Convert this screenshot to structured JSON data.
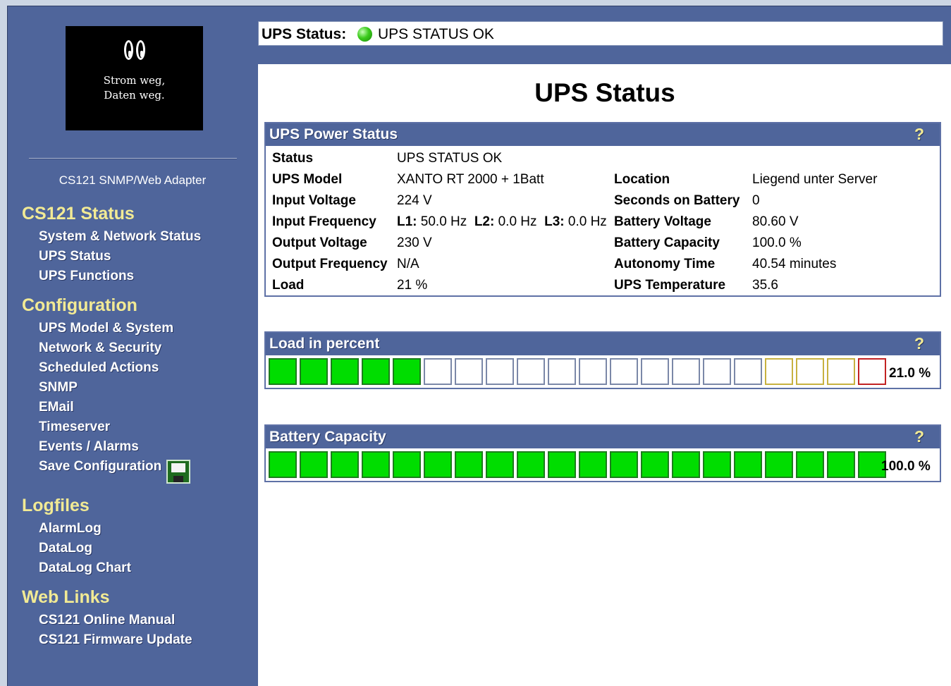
{
  "logo": {
    "line1": "Strom weg,",
    "line2": "Daten weg."
  },
  "sidebar": {
    "adapter_name": "CS121 SNMP/Web Adapter",
    "sections": [
      {
        "title": "CS121 Status",
        "items": [
          "System & Network Status",
          "UPS Status",
          "UPS Functions"
        ]
      },
      {
        "title": "Configuration",
        "items": [
          "UPS Model & System",
          "Network & Security",
          "Scheduled Actions",
          "SNMP",
          "EMail",
          "Timeserver",
          "Events / Alarms",
          "Save Configuration"
        ]
      },
      {
        "title": "Logfiles",
        "items": [
          "AlarmLog",
          "DataLog",
          "DataLog Chart"
        ]
      },
      {
        "title": "Web Links",
        "items": [
          "CS121 Online Manual",
          "CS121 Firmware Update"
        ]
      }
    ]
  },
  "status_bar": {
    "label": "UPS Status:",
    "value": "UPS STATUS OK",
    "led_color": "#3ccb1c"
  },
  "page_title": "UPS Status",
  "power_panel": {
    "title": "UPS Power Status",
    "help": "?",
    "left": [
      {
        "label": "Status",
        "value": "UPS STATUS OK"
      },
      {
        "label": "UPS Model",
        "value": "XANTO RT 2000 + 1Batt"
      },
      {
        "label": "Input Voltage",
        "value": "224 V"
      },
      {
        "label": "Input Frequency",
        "value": ""
      },
      {
        "label": "Output Voltage",
        "value": "230 V"
      },
      {
        "label": "Output Frequency",
        "value": "N/A"
      },
      {
        "label": "Load",
        "value": "21 %"
      }
    ],
    "freq": {
      "l1_label": "L1:",
      "l1": "50.0 Hz",
      "l2_label": "L2:",
      "l2": "0.0 Hz",
      "l3_label": "L3:",
      "l3": "0.0 Hz"
    },
    "right": [
      {
        "label": "Location",
        "value": "Liegend unter Server"
      },
      {
        "label": "Seconds on Battery",
        "value": "0"
      },
      {
        "label": "Battery Voltage",
        "value": "80.60 V"
      },
      {
        "label": "Battery Capacity",
        "value": "100.0 %"
      },
      {
        "label": "Autonomy Time",
        "value": "40.54 minutes"
      },
      {
        "label": "UPS Temperature",
        "value": "35.6"
      }
    ]
  },
  "load_panel": {
    "title": "Load in percent",
    "help": "?",
    "percent_text": "21.0 %",
    "filled_segments": 5,
    "total_segments": 20,
    "warn_segments": 3,
    "crit_segments": 1
  },
  "battery_panel": {
    "title": "Battery Capacity",
    "help": "?",
    "percent_text": "100.0 %",
    "filled_segments": 20,
    "total_segments": 20
  }
}
